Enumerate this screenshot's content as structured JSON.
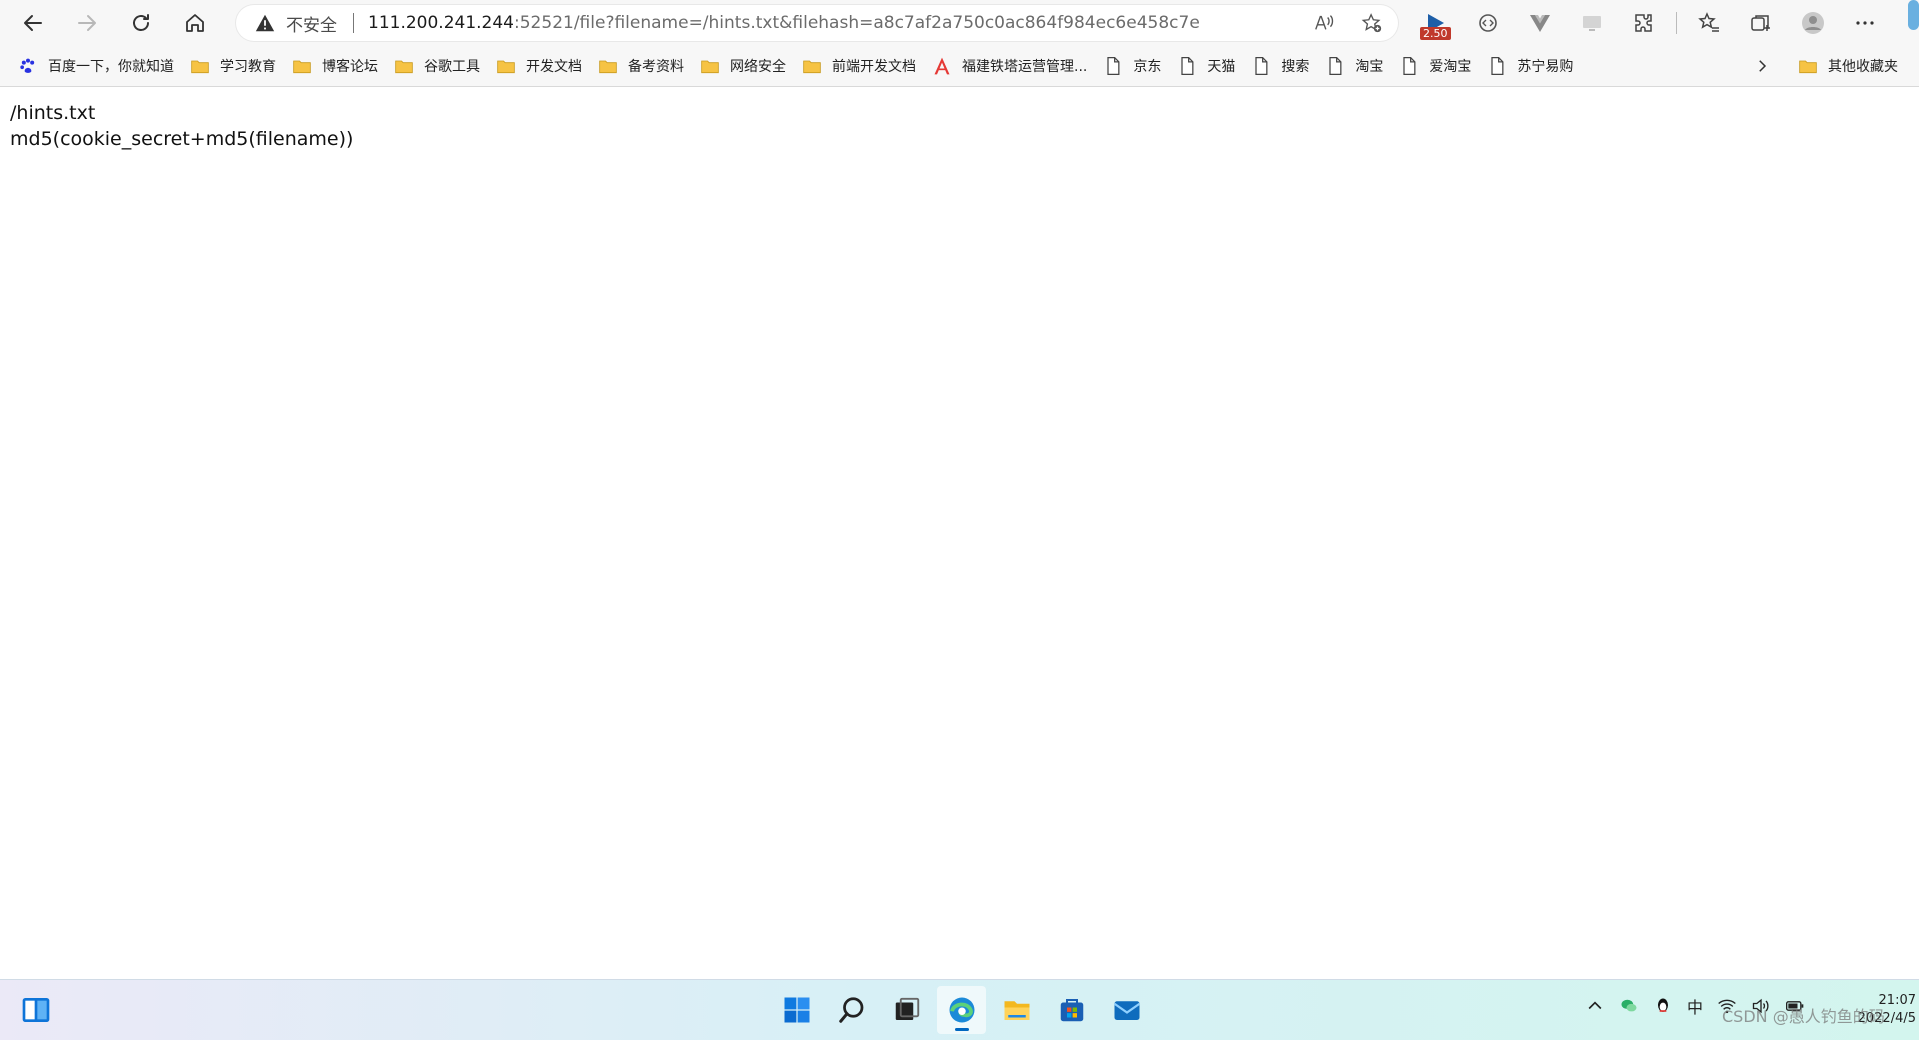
{
  "address_bar": {
    "security_label": "不安全",
    "url_host": "111.200.241.244",
    "url_rest": ":52521/file?filename=/hints.txt&filehash=a8c7af2a750c0ac864f984ec6e458c7e"
  },
  "extensions": {
    "badge_text": "2.50"
  },
  "bookmarks": {
    "items": [
      {
        "label": "百度一下，你就知道",
        "icon": "paw-icon"
      },
      {
        "label": "学习教育",
        "icon": "folder-icon"
      },
      {
        "label": "博客论坛",
        "icon": "folder-icon"
      },
      {
        "label": "谷歌工具",
        "icon": "folder-icon"
      },
      {
        "label": "开发文档",
        "icon": "folder-icon"
      },
      {
        "label": "备考资料",
        "icon": "folder-icon"
      },
      {
        "label": "网络安全",
        "icon": "folder-icon"
      },
      {
        "label": "前端开发文档",
        "icon": "folder-icon"
      },
      {
        "label": "福建铁塔运营管理...",
        "icon": "tower-icon"
      },
      {
        "label": "京东",
        "icon": "page-icon"
      },
      {
        "label": "天猫",
        "icon": "page-icon"
      },
      {
        "label": "搜索",
        "icon": "page-icon"
      },
      {
        "label": "淘宝",
        "icon": "page-icon"
      },
      {
        "label": "爱淘宝",
        "icon": "page-icon"
      },
      {
        "label": "苏宁易购",
        "icon": "page-icon"
      }
    ],
    "other_label": "其他收藏夹"
  },
  "content": {
    "line1": "/hints.txt",
    "line2": "md5(cookie_secret+md5(filename))"
  },
  "taskbar": {
    "ime_label": "中",
    "time": "21:07",
    "date": "2022/4/5"
  },
  "watermark": "CSDN @愚人钓鱼的码"
}
